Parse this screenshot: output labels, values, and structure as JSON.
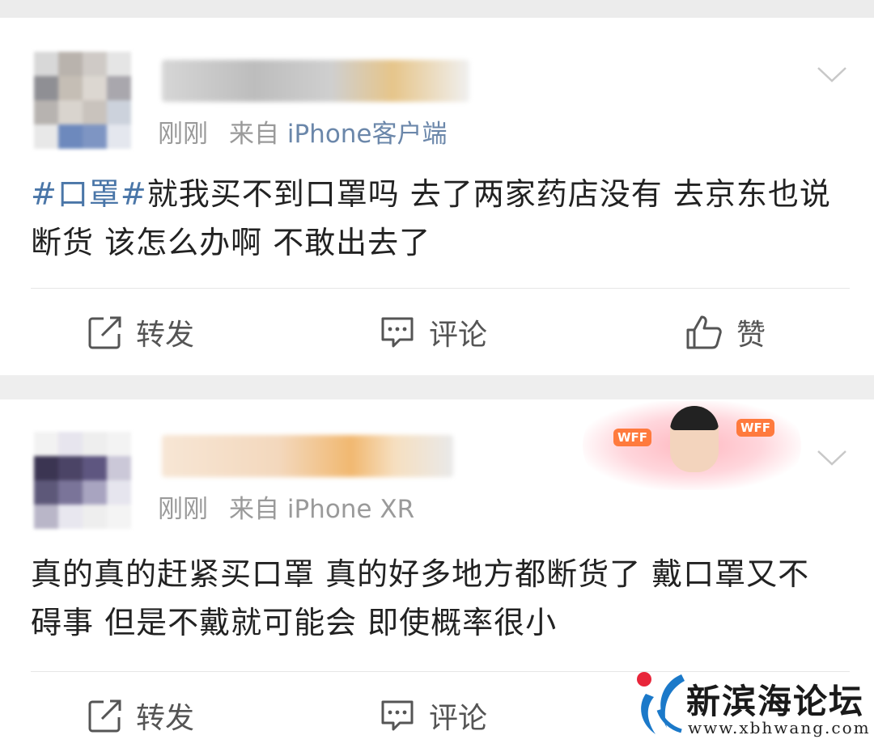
{
  "posts": [
    {
      "time": "刚刚",
      "source_prefix": "来自",
      "source_device": "iPhone客户端",
      "hashtag": "#口罩#",
      "content": "就我买不到口罩吗 去了两家药店没有 去京东也说断货 该怎么办啊 不敢出去了",
      "actions": {
        "repost": "转发",
        "comment": "评论",
        "like": "赞"
      }
    },
    {
      "time": "刚刚",
      "source_prefix": "来自",
      "source_device": "iPhone XR",
      "content": "真的真的赶紧买口罩 真的好多地方都断货了 戴口罩又不碍事 但是不戴就可能会 即使概率很小",
      "badge_text": "WFF",
      "actions": {
        "repost": "转发",
        "comment": "评论"
      }
    }
  ],
  "watermark": {
    "title": "新滨海论坛",
    "url": "www.xbhwang.com"
  },
  "colors": {
    "hashtag": "#4a76a8",
    "source_link": "#6b87aa",
    "meta": "#9a9a9a"
  }
}
